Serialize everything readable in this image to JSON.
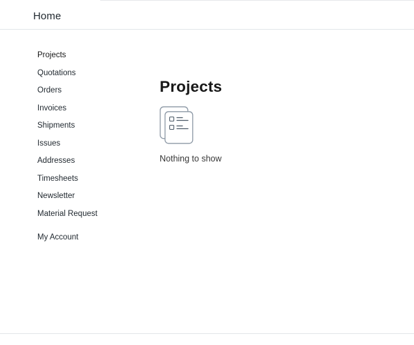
{
  "navbar": {
    "brand": "Home"
  },
  "sidebar": {
    "items": [
      {
        "label": "Projects",
        "active": true
      },
      {
        "label": "Quotations",
        "active": false
      },
      {
        "label": "Orders",
        "active": false
      },
      {
        "label": "Invoices",
        "active": false
      },
      {
        "label": "Shipments",
        "active": false
      },
      {
        "label": "Issues",
        "active": false
      },
      {
        "label": "Addresses",
        "active": false
      },
      {
        "label": "Timesheets",
        "active": false
      },
      {
        "label": "Newsletter",
        "active": false
      },
      {
        "label": "Material Request",
        "active": false
      }
    ],
    "account": {
      "label": "My Account"
    }
  },
  "main": {
    "title": "Projects",
    "empty_icon": "empty-list-icon",
    "empty_text": "Nothing to show"
  },
  "colors": {
    "text": "#1f272e",
    "muted_text": "#383838",
    "border": "#e2e6e9",
    "icon_stroke": "#8d99a6"
  }
}
